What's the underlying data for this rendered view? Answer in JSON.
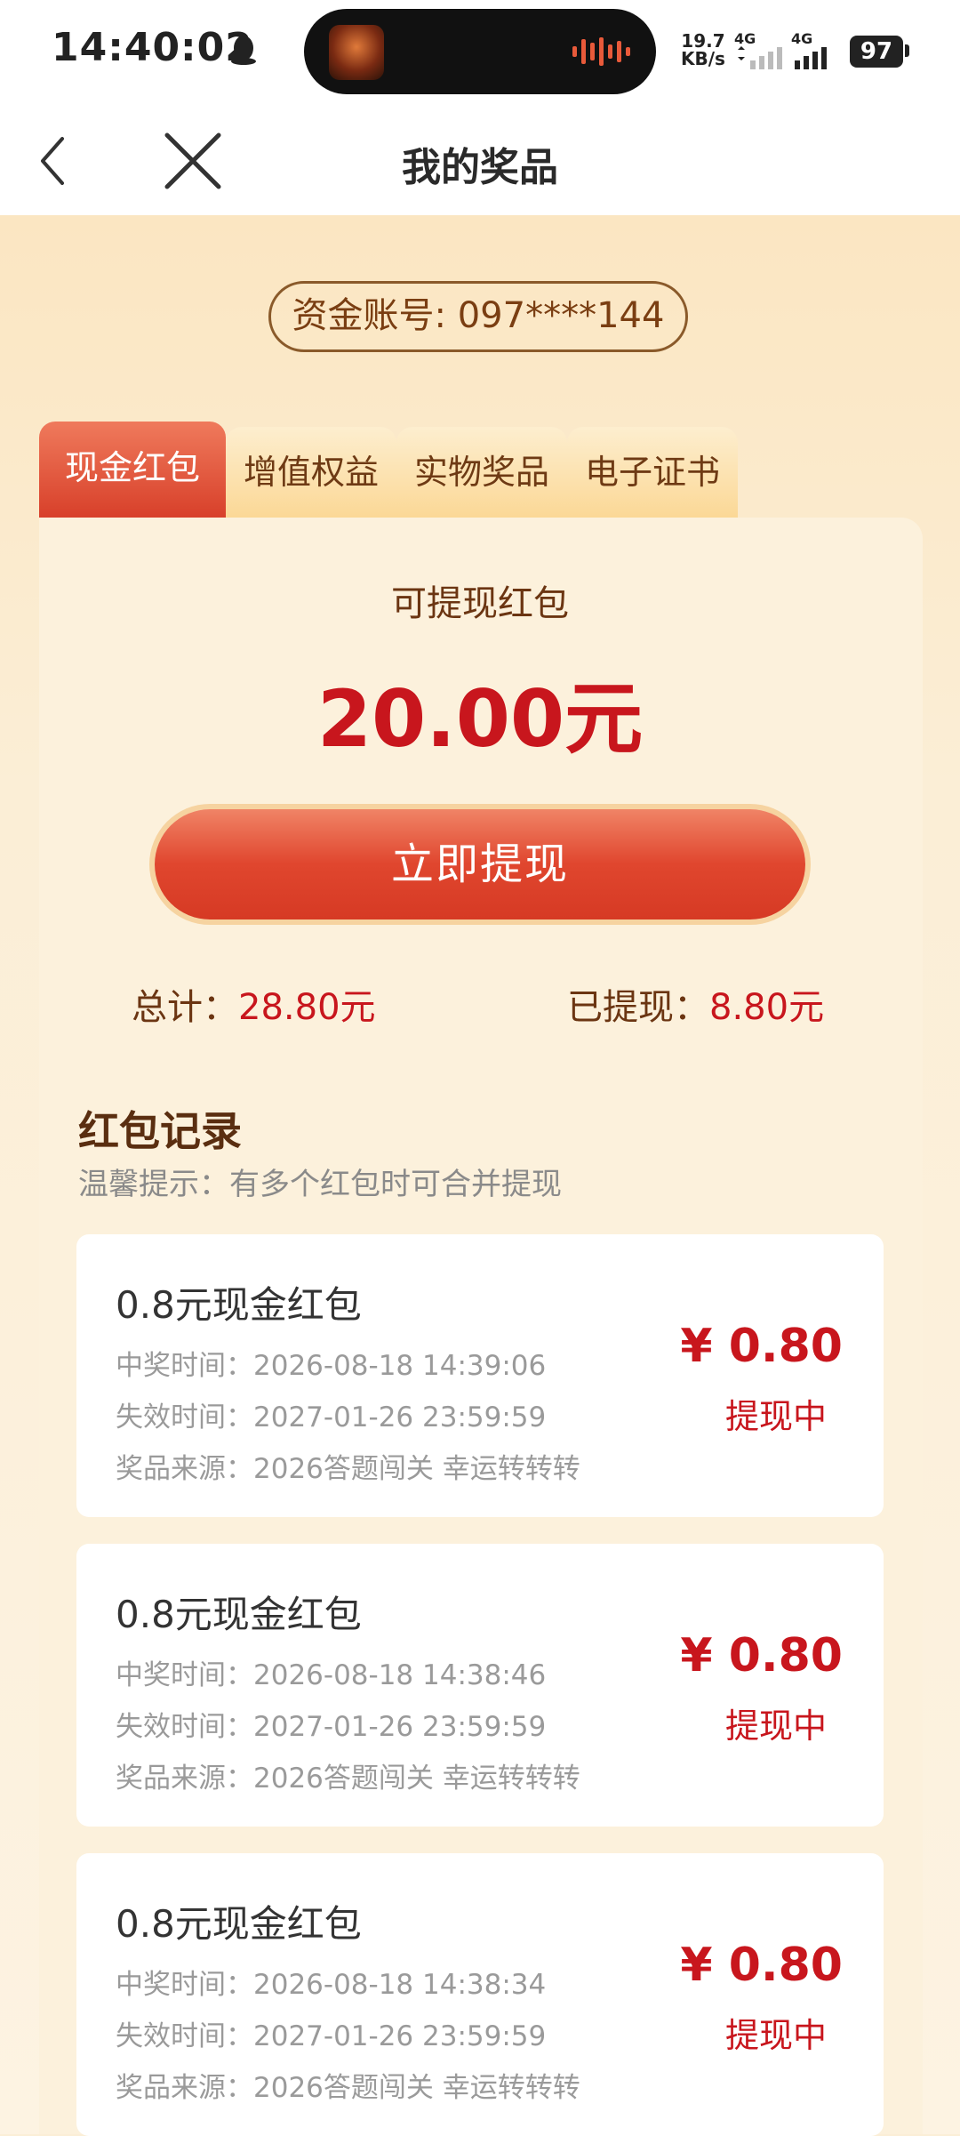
{
  "status_bar": {
    "time": "14:40:02",
    "net_speed_value": "19.7",
    "net_speed_unit": "KB/s",
    "sig1_label": "4G",
    "sig2_label": "4G",
    "battery": "97"
  },
  "nav": {
    "title": "我的奖品"
  },
  "account": {
    "text": "资金账号: 097****144"
  },
  "tabs": [
    {
      "label": "现金红包",
      "active": true
    },
    {
      "label": "增值权益",
      "active": false
    },
    {
      "label": "实物奖品",
      "active": false
    },
    {
      "label": "电子证书",
      "active": false
    }
  ],
  "summary": {
    "label": "可提现红包",
    "amount": "20.00元",
    "button": "立即提现",
    "total_label": "总计：",
    "total_value": "28.80元",
    "withdrawn_label": "已提现：",
    "withdrawn_value": "8.80元"
  },
  "records_section": {
    "title": "红包记录",
    "tip": "温馨提示：有多个红包时可合并提现"
  },
  "records": [
    {
      "title": "0.8元现金红包",
      "win_time": "中奖时间：2026-08-18 14:39:06",
      "expire_time": "失效时间：2027-01-26 23:59:59",
      "source": "奖品来源：2026答题闯关 幸运转转转",
      "amount": "¥ 0.80",
      "status": "提现中"
    },
    {
      "title": "0.8元现金红包",
      "win_time": "中奖时间：2026-08-18 14:38:46",
      "expire_time": "失效时间：2027-01-26 23:59:59",
      "source": "奖品来源：2026答题闯关 幸运转转转",
      "amount": "¥ 0.80",
      "status": "提现中"
    },
    {
      "title": "0.8元现金红包",
      "win_time": "中奖时间：2026-08-18 14:38:34",
      "expire_time": "失效时间：2027-01-26 23:59:59",
      "source": "奖品来源：2026答题闯关 幸运转转转",
      "amount": "¥ 0.80",
      "status": "提现中"
    }
  ],
  "colors": {
    "accent_red": "#c8161d",
    "tab_active": "#d8402a",
    "page_bg": "#fbeed6"
  }
}
